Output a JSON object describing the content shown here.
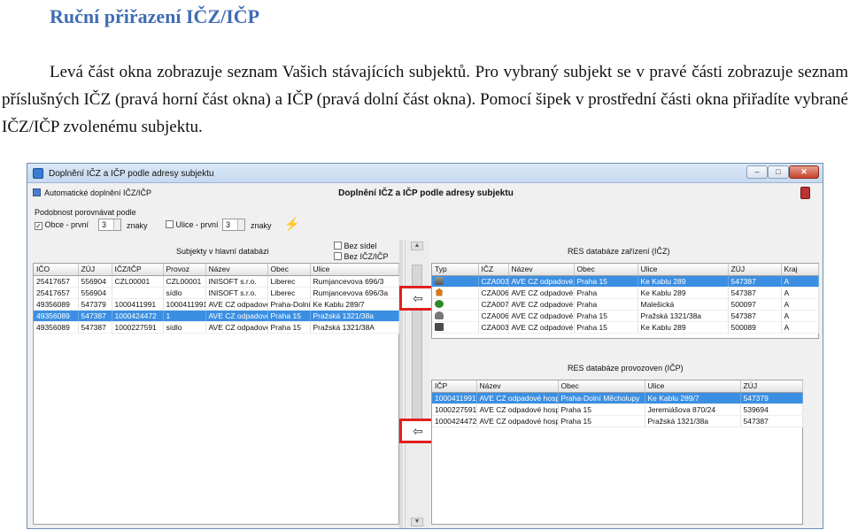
{
  "document": {
    "title": "Ruční přiřazení IČZ/IČP",
    "paragraph": "Levá část okna zobrazuje seznam Vašich stávajících subjektů. Pro vybraný subjekt se v pravé části zobrazuje seznam příslušných IČZ (pravá horní část okna) a IČP (pravá dolní část okna). Pomocí šipek v prostřední části okna přiřadíte vybrané IČZ/IČP zvolenému subjektu."
  },
  "window": {
    "title": "Doplnění IČZ a IČP podle adresy subjektu",
    "controls": {
      "minimize": "–",
      "maximize": "□",
      "close": "✕"
    },
    "menu_item": "Automatické doplnění IČZ/IČP",
    "form_title": "Doplnění IČZ a IČP podle adresy subjektu"
  },
  "options": {
    "label": "Podobnost porovnávat podle",
    "obce": {
      "label": "Obce - první",
      "checked": true,
      "value": "3",
      "unit": "znaky"
    },
    "ulice": {
      "label": "Ulice - první",
      "checked": false,
      "value": "3",
      "unit": "znaky"
    }
  },
  "left": {
    "title": "Subjekty v hlavní databázi",
    "filters": [
      {
        "label": "Bez sídel",
        "checked": false
      },
      {
        "label": "Bez IČZ/IČP",
        "checked": false
      }
    ],
    "columns": [
      "IČO",
      "ZÚJ",
      "IČZ/IČP",
      "Provoz",
      "Název",
      "Obec",
      "Ulice"
    ],
    "rows": [
      {
        "cells": [
          "25417657",
          "556904",
          "CZL00001",
          "CZL00001",
          "INISOFT s.r.o.",
          "Liberec",
          "Rumjancevova 696/3"
        ],
        "selected": false
      },
      {
        "cells": [
          "25417657",
          "556904",
          "",
          "sídlo",
          "INISOFT s.r.o.",
          "Liberec",
          "Rumjancevova 696/3a"
        ],
        "selected": false
      },
      {
        "cells": [
          "49356089",
          "547379",
          "1000411991",
          "1000411991",
          "AVE CZ odpadové",
          "Praha-Dolní",
          "Ke Kablu 289/7"
        ],
        "selected": false
      },
      {
        "cells": [
          "49356089",
          "547387",
          "1000424472",
          "1",
          "AVE CZ odpadové",
          "Praha 15",
          "Pražská 1321/38a"
        ],
        "selected": true
      },
      {
        "cells": [
          "49356089",
          "547387",
          "1000227591",
          "sídlo",
          "AVE CZ odpadové",
          "Praha 15",
          "Pražská 1321/38A"
        ],
        "selected": false
      }
    ]
  },
  "middle": {
    "assign_icz_arrow": "⇦",
    "assign_icp_arrow": "⇦"
  },
  "right_top": {
    "title": "RES databáze zařízení (IČZ)",
    "columns": [
      "Typ",
      "IČZ",
      "Název",
      "Obec",
      "Ulice",
      "ZÚJ",
      "Kraj"
    ],
    "rows": [
      {
        "icon": "truck-icon",
        "cells": [
          "CZA00385",
          "AVE CZ odpadové h",
          "Praha 15",
          "Ke Kablu 289",
          "547387",
          "A"
        ],
        "selected": true
      },
      {
        "icon": "house-icon",
        "cells": [
          "CZA00664",
          "AVE CZ odpadové h",
          "Praha",
          "Ke Kablu 289",
          "547387",
          "A"
        ],
        "selected": false
      },
      {
        "icon": "tree-icon",
        "cells": [
          "CZA00789",
          "AVE CZ odpadové h",
          "Praha",
          "Malešická",
          "500097",
          "A"
        ],
        "selected": false
      },
      {
        "icon": "wagon-icon",
        "cells": [
          "CZA00674",
          "AVE CZ odpadové h",
          "Praha 15",
          "Pražská 1321/38a",
          "547387",
          "A"
        ],
        "selected": false
      },
      {
        "icon": "bus-icon",
        "cells": [
          "CZA00385",
          "AVE CZ odpadové h",
          "Praha 15",
          "Ke Kablu 289",
          "500089",
          "A"
        ],
        "selected": false
      }
    ]
  },
  "right_bottom": {
    "title": "RES databáze provozoven (IČP)",
    "columns": [
      "IČP",
      "Název",
      "Obec",
      "Ulice",
      "ZÚJ"
    ],
    "rows": [
      {
        "cells": [
          "1000411991",
          "AVE CZ odpadové hospodářství",
          "Praha-Dolní Měcholupy",
          "Ke Kablu 289/7",
          "547379"
        ],
        "selected": true
      },
      {
        "cells": [
          "1000227591",
          "AVE CZ odpadové hospodářstv",
          "Praha 15",
          "Jeremiášova 870/24",
          "539694"
        ],
        "selected": false
      },
      {
        "cells": [
          "1000424472",
          "AVE CZ odpadové hospodářstv",
          "Praha 15",
          "Pražská 1321/38a",
          "547387"
        ],
        "selected": false
      }
    ]
  }
}
